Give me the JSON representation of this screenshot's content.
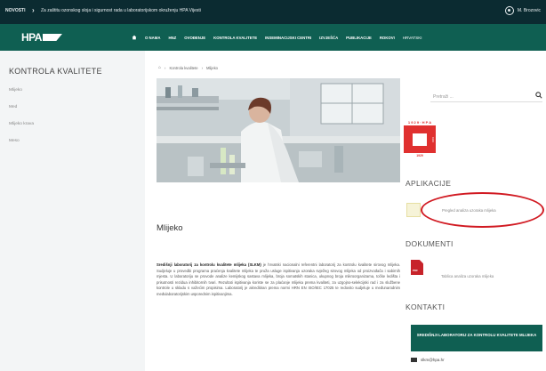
{
  "topbar": {
    "news_label": "NOVOSTI",
    "news_text": "Za zaštitu ozonskog sloja i sigurnost rada u laboratorijskom okruženju HPA Vijesti",
    "user_name": "M. Brozovic"
  },
  "nav": {
    "logo_text": "HPA",
    "items": [
      "O NAMA",
      "HNZ",
      "OVOĐENJE",
      "KONTROLA KVALITETE",
      "INSEMINACIJSKI CENTRI",
      "IZVJEŠĆA",
      "PUBLIKACIJE",
      "ROKOVI"
    ],
    "lang": "HRVATSKI"
  },
  "sidebar": {
    "title": "KONTROLA KVALITETE",
    "items": [
      "Mlijeko",
      "Med",
      "Mlijeko krava",
      "Meso"
    ]
  },
  "breadcrumb": {
    "items": [
      "Kontrola kvalitete",
      "Mlijeko"
    ]
  },
  "main": {
    "title": "Mlijeko",
    "lead_bold": "Središnji laboratorij za kontrolu kvalitete mlijeka (SLKM)",
    "body": "je hrvatski nacionalni referentni laboratorij za kontrolu kvalitete sirovog mlijeka. Sudjeluje u provedbi programa praćenja kvalitete mlijeka te pruža usluge ispitivanja uzoraka svježeg sirovog mlijeka od proizvođača i sabirnih mjesta. U laboratoriju se provode analize kemijskog sastava mlijeka, broja somatskih stanica, ukupnog broja mikroorganizama, točke ledišta i prisutnosti rezidua inhibitornih tvari. Rezultati ispitivanja koriste se za plaćanje mlijeka prema kvaliteti, za uzgojno-selekcijski rad i za službene kontrole u skladu s važećim propisima. Laboratorij je akreditiran prema normi HRN EN ISO/IEC 17025 te redovito sudjeluje u međunarodnim međulaboratorijskim usporednim ispitivanjima."
  },
  "right": {
    "search_placeholder": "Pretraži ...",
    "apps_title": "APLIKACIJE",
    "app_label": "Pregled analiza uzoraka mlijeka",
    "docs_title": "DOKUMENTI",
    "doc_label": "Tablica analiza uzoraka mlijeka",
    "doc_badge": "PDF",
    "contacts_title": "KONTAKTI",
    "contact_button": "SREDIŠNJI LABORATORIJ ZA KONTROLU KVALITETE MLIJEKA",
    "email": "slkm@hpa.hr",
    "logo_caption_top": "1 9 2 9 · H P A",
    "logo_caption_side": "1994",
    "logo_caption_bottom": "1929"
  },
  "colors": {
    "nav_green": "#0f5f52",
    "topbar_dark": "#0b2b31",
    "logo_red": "#e0302f",
    "highlight_red": "#d11a22"
  }
}
